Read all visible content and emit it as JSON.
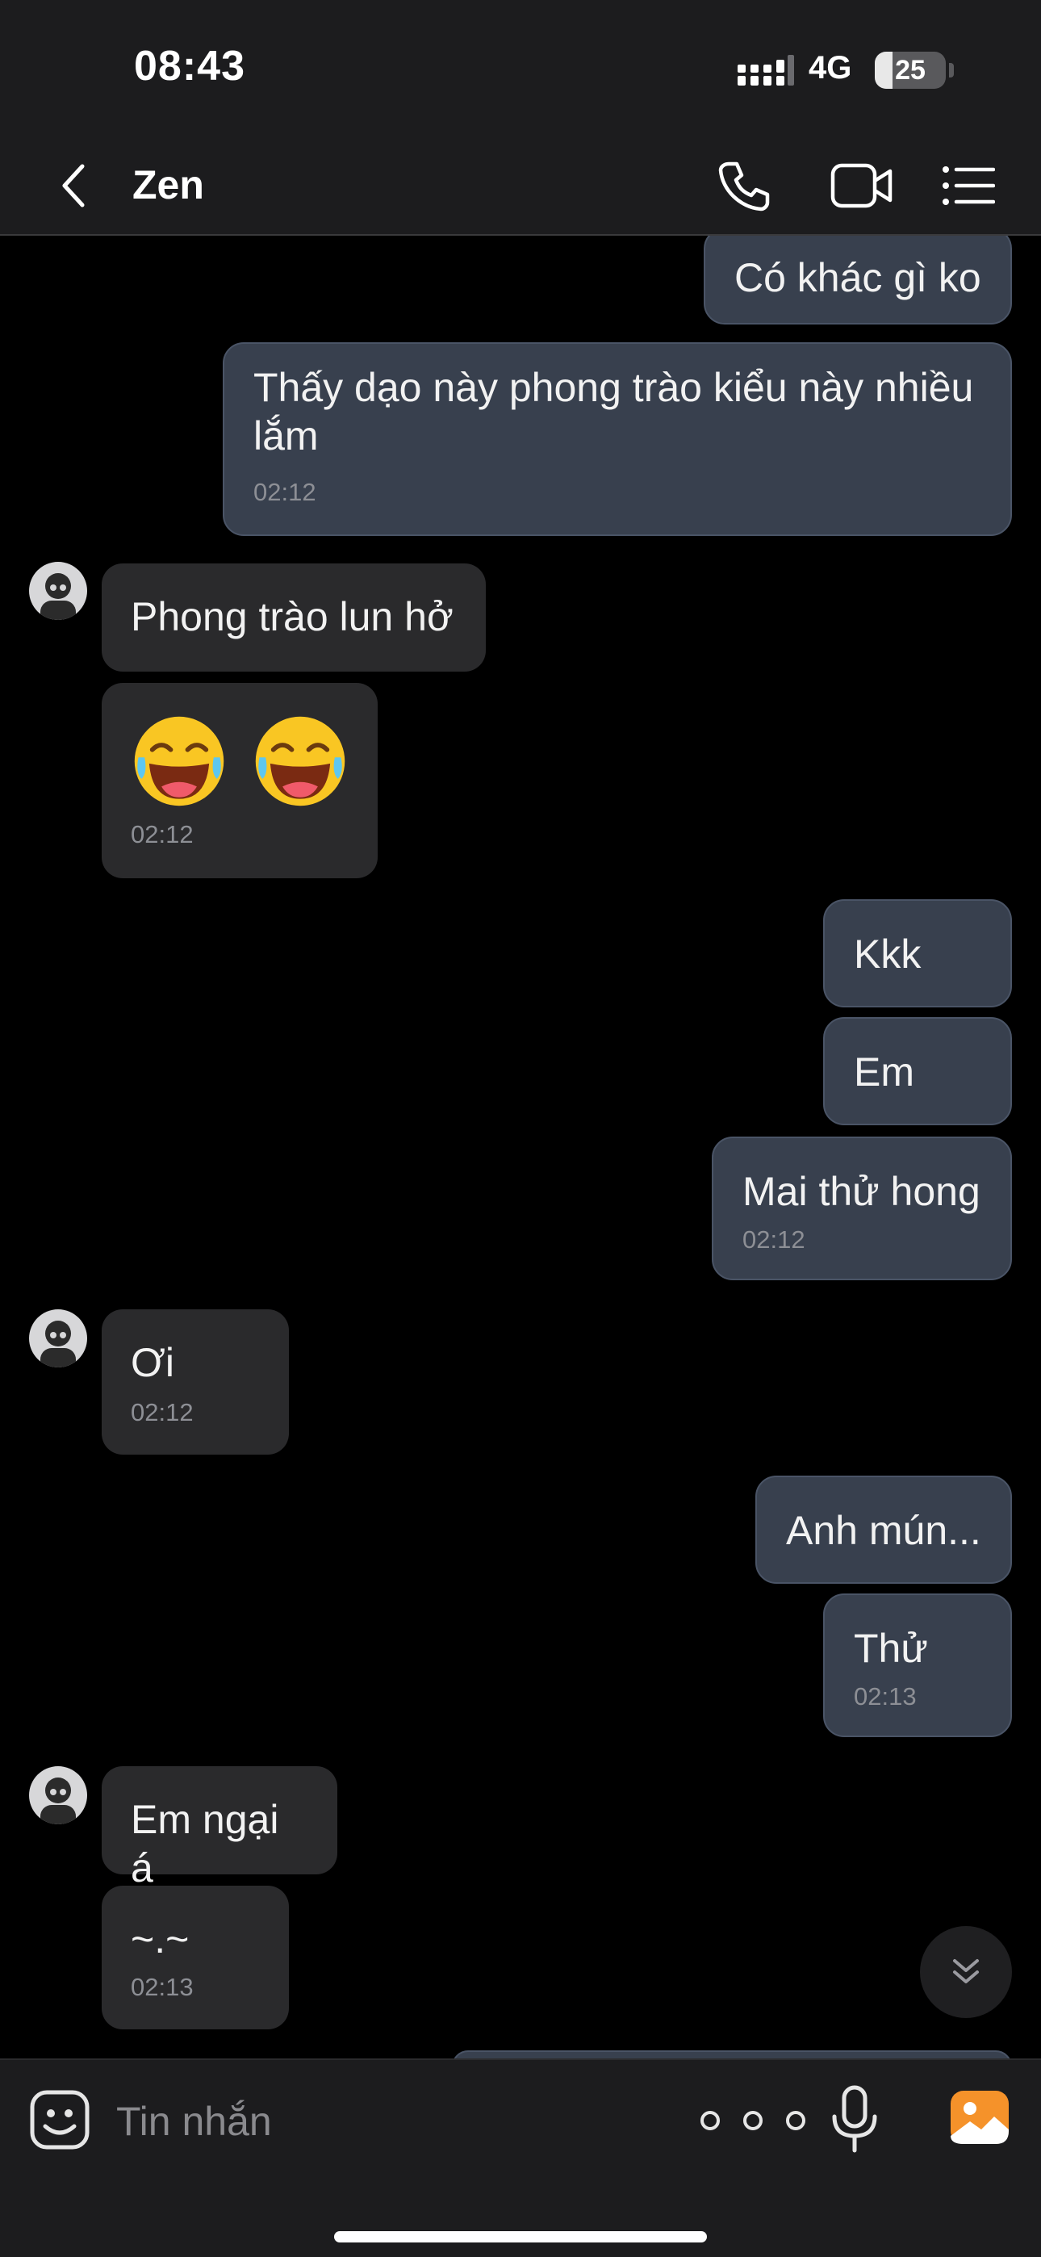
{
  "status_bar": {
    "time": "08:43",
    "network": "4G",
    "battery": "25"
  },
  "header": {
    "title": "Zen",
    "icons": [
      "back-icon",
      "phone-icon",
      "video-camera-icon",
      "menu-list-icon"
    ]
  },
  "messages": [
    {
      "direction": "out",
      "text": "Có khác gì ko"
    },
    {
      "direction": "out",
      "text": "Thấy dạo này phong trào kiểu này nhiều lắm",
      "time": "02:12"
    },
    {
      "direction": "in",
      "text": "Phong trào lun hở"
    },
    {
      "direction": "in",
      "emoji": [
        "😂",
        "😂"
      ],
      "time": "02:12"
    },
    {
      "direction": "out",
      "text": "Kkk"
    },
    {
      "direction": "out",
      "text": "Em"
    },
    {
      "direction": "out",
      "text": "Mai thử hong",
      "time": "02:12"
    },
    {
      "direction": "in",
      "text": "Ơi",
      "time": "02:12"
    },
    {
      "direction": "out",
      "text": "Anh mún..."
    },
    {
      "direction": "out",
      "text": "Thử",
      "time": "02:13"
    },
    {
      "direction": "in",
      "text": "Em ngại á"
    },
    {
      "direction": "in",
      "text": "~.~",
      "time": "02:13"
    }
  ],
  "input": {
    "placeholder": "Tin nhắn"
  },
  "colors": {
    "outgoing_bubble": "#38404e",
    "incoming_bubble": "#2a2a2c",
    "header_bg": "#1c1c1e",
    "photo_accent": "#f5922a"
  }
}
